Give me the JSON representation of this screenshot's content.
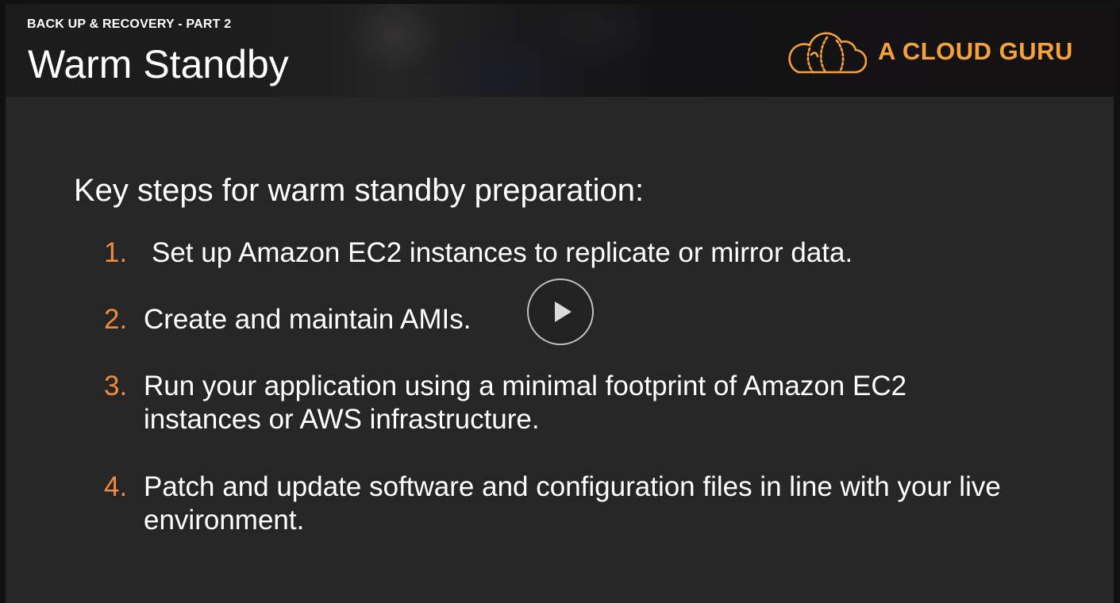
{
  "header": {
    "subtitle": "BACK UP & RECOVERY - PART 2",
    "title": "Warm Standby",
    "logo_text": "A CLOUD GURU"
  },
  "content": {
    "heading": "Key steps for warm standby preparation:",
    "steps": [
      {
        "num": "1.",
        "text": "Set up Amazon EC2 instances to replicate or mirror data."
      },
      {
        "num": "2.",
        "text": "Create and maintain AMIs."
      },
      {
        "num": "3.",
        "text": "Run your application using a minimal footprint of Amazon EC2 instances or AWS infrastructure."
      },
      {
        "num": "4.",
        "text": "Patch and update software and configuration files in line with your live environment."
      }
    ]
  },
  "player": {
    "play_icon": "play-icon"
  },
  "colors": {
    "accent": "#f08a3c",
    "logo": "#f5a23b",
    "background": "#262626",
    "text": "#ffffff"
  }
}
